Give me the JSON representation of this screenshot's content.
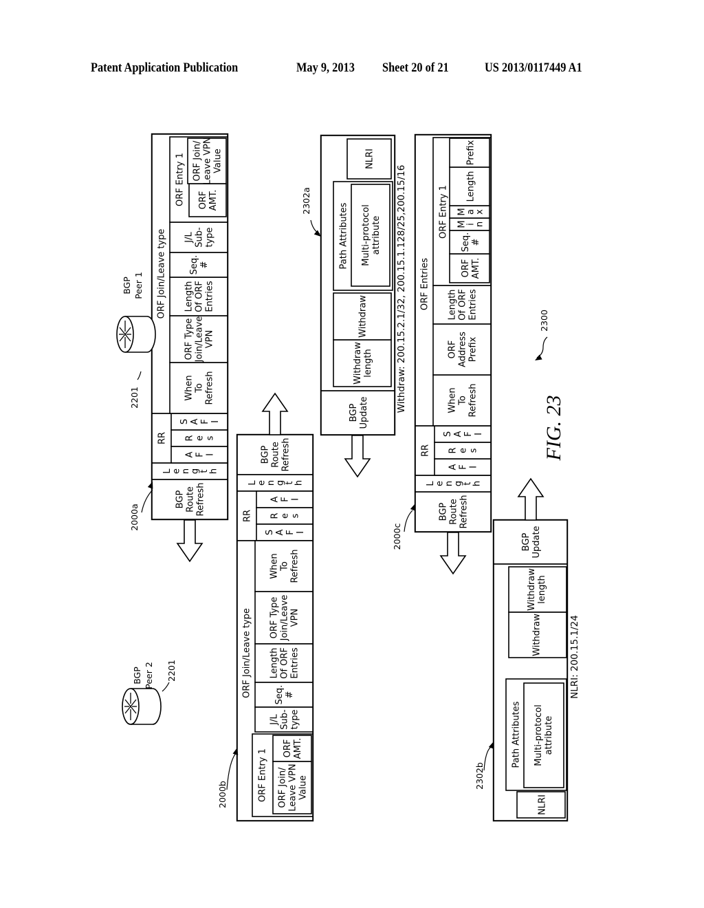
{
  "header": {
    "publication": "Patent Application Publication",
    "date": "May 9, 2013",
    "sheet": "Sheet 20 of 21",
    "number": "US 2013/0117449 A1"
  },
  "figure": {
    "label": "FIG. 23",
    "ref": "2300"
  },
  "peers": [
    {
      "ref": "2201",
      "label": "BGP\nPeer 1"
    },
    {
      "ref": "2201",
      "label": "BGP\nPeer 2"
    }
  ],
  "packets": {
    "p2000a": {
      "ref": "2000a",
      "type": "BGP\nRoute\nRefresh",
      "length": "L\ne\nn\ng\nt\nh",
      "rr": "RR",
      "afi": "A\nF\nI",
      "res": "R\ne\ns",
      "safi": "S\nA\nF\nI",
      "orf_group": "ORF Join/Leave type",
      "when": "When\nTo\nRefresh",
      "orf_type": "ORF Type\nJoin/Leave\nVPN",
      "len_entries": "Length\nOf ORF\nEntries",
      "seq": "Seq.\n#",
      "jl_subtype": "J/L\nSub-\ntype",
      "entry": "ORF Entry 1",
      "orf_amt": "ORF\nAMT.",
      "vpn_value": "ORF Join/\nLeave VPN\nValue"
    },
    "p2000b": {
      "ref": "2000b",
      "type": "BGP\nRoute\nRefresh",
      "length": "L\ne\nn\ng\nt\nh",
      "rr": "RR",
      "afi": "A\nF\nI",
      "res": "R\ne\ns",
      "safi": "S\nA\nF\nI",
      "orf_group": "ORF Join/Leave type",
      "when": "When\nTo\nRefresh",
      "orf_type": "ORF Type\nJoin/Leave\nVPN",
      "len_entries": "Length\nOf ORF\nEntries",
      "seq": "Seq.\n#",
      "jl_subtype": "J/L\nSub-\ntype",
      "entry": "ORF Entry 1",
      "orf_amt": "ORF\nAMT.",
      "vpn_value": "ORF Join/\nLeave VPN\nValue"
    },
    "p2000c": {
      "ref": "2000c",
      "type": "BGP\nRoute\nRefresh",
      "length": "L\ne\nn\ng\nt\nh",
      "rr": "RR",
      "afi": "A\nF\nI",
      "res": "R\ne\ns",
      "safi": "S\nA\nF\nI",
      "orf_group": "ORF Entries",
      "when": "When\nTo\nRefresh",
      "orf_addr": "ORF\nAddress\nPrefix",
      "len_entries": "Length\nOf ORF\nEntries",
      "entry": "ORF Entry 1",
      "orf_amt": "ORF\nAMT.",
      "seq": "Seq.\n#",
      "min": "M\ni\nn",
      "max": "M\na\nx",
      "length_field": "Length",
      "prefix": "Prefix"
    },
    "p2302a": {
      "ref": "2302a",
      "type": "BGP\nUpdate",
      "withdraw_length": "Withdraw\nlength",
      "withdraw": "Withdraw",
      "path_attrs": "Path Attributes",
      "mp_attr": "Multi-protocol\nattribute",
      "nlri": "NLRI",
      "caption": "Withdraw:  200.15.2.1/32,  200.15.1.128/25,200.15/16"
    },
    "p2302b": {
      "ref": "2302b",
      "type": "BGP\nUpdate",
      "withdraw_length": "Withdraw\nlength",
      "withdraw": "Withdraw",
      "path_attrs": "Path Attributes",
      "mp_attr": "Multi-protocol\nattribute",
      "nlri": "NLRI",
      "caption": "NLRI: 200.15.1/24"
    }
  }
}
